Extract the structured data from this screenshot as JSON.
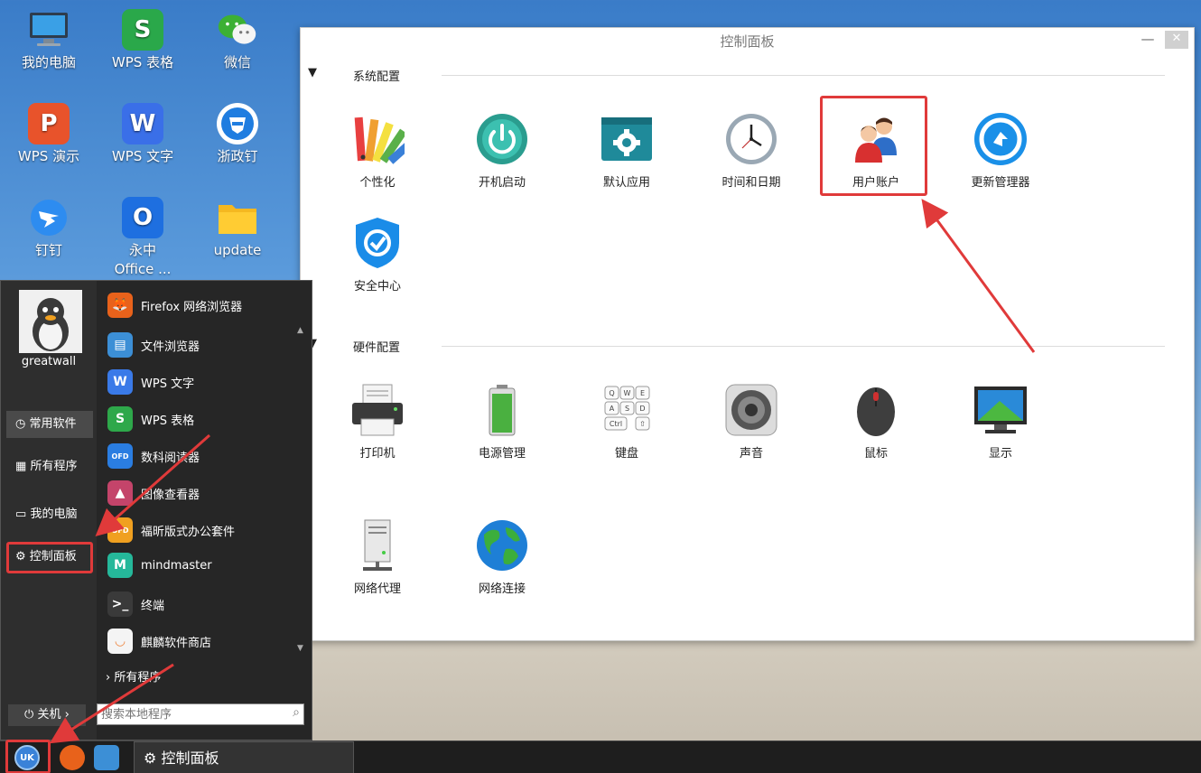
{
  "desktop": {
    "icons": [
      {
        "label": "我的电脑",
        "icon": "computer-icon"
      },
      {
        "label": "WPS 表格",
        "icon": "wps-spreadsheet-icon",
        "glyph": "S"
      },
      {
        "label": "微信",
        "icon": "wechat-icon"
      },
      {
        "label": "WPS 演示",
        "icon": "wps-presentation-icon",
        "glyph": "P"
      },
      {
        "label": "WPS 文字",
        "icon": "wps-writer-icon",
        "glyph": "W"
      },
      {
        "label": "浙政钉",
        "icon": "zhezhengding-icon"
      },
      {
        "label": "钉钉",
        "icon": "dingtalk-icon"
      },
      {
        "label": "永中",
        "label2": "Office ...",
        "icon": "yozo-office-icon",
        "glyph": "O"
      },
      {
        "label": "update",
        "icon": "folder-icon"
      }
    ]
  },
  "window": {
    "title": "控制面板",
    "minimize": "—",
    "close": "✕",
    "sections": [
      {
        "label": "系统配置",
        "items": [
          "个性化",
          "开机启动",
          "默认应用",
          "时间和日期",
          "用户账户",
          "更新管理器",
          "安全中心"
        ]
      },
      {
        "label": "硬件配置",
        "items": [
          "打印机",
          "电源管理",
          "键盘",
          "声音",
          "鼠标",
          "显示",
          "网络代理",
          "网络连接"
        ]
      }
    ],
    "keyboard_keys": [
      "Q",
      "W",
      "E",
      "A",
      "S",
      "D",
      "Ctrl",
      "⇧"
    ]
  },
  "start_menu": {
    "username": "greatwall",
    "categories": [
      "常用软件",
      "所有程序",
      "我的电脑",
      "控制面板"
    ],
    "apps": [
      {
        "label": "Firefox 网络浏览器",
        "glyph": "🦊",
        "color": "#e8621b"
      },
      {
        "label": "文件浏览器",
        "glyph": "▤",
        "color": "#3c8fd6"
      },
      {
        "label": "WPS 文字",
        "glyph": "W",
        "color": "#3a7ae8"
      },
      {
        "label": "WPS 表格",
        "glyph": "S",
        "color": "#2ea84a"
      },
      {
        "label": "数科阅读器",
        "glyph": "OFD",
        "color": "#2a7de1"
      },
      {
        "label": "图像查看器",
        "glyph": "▲",
        "color": "#c4446a"
      },
      {
        "label": "福昕版式办公套件",
        "glyph": "OFD",
        "color": "#f0a020"
      },
      {
        "label": "mindmaster",
        "glyph": "M",
        "color": "#25b89a"
      },
      {
        "label": "终端",
        "glyph": ">_",
        "color": "#3a3a3a"
      },
      {
        "label": "麒麟软件商店",
        "glyph": "◡",
        "color": "#f4f4f4"
      }
    ],
    "all_programs": "所有程序",
    "shutdown": "关机",
    "search_placeholder": "搜索本地程序"
  },
  "taskbar": {
    "start": "UK",
    "active_task": "控制面板"
  },
  "colors": {
    "highlight": "#e03a3a",
    "menu_bg": "#262626",
    "window_bg": "#ffffff"
  }
}
